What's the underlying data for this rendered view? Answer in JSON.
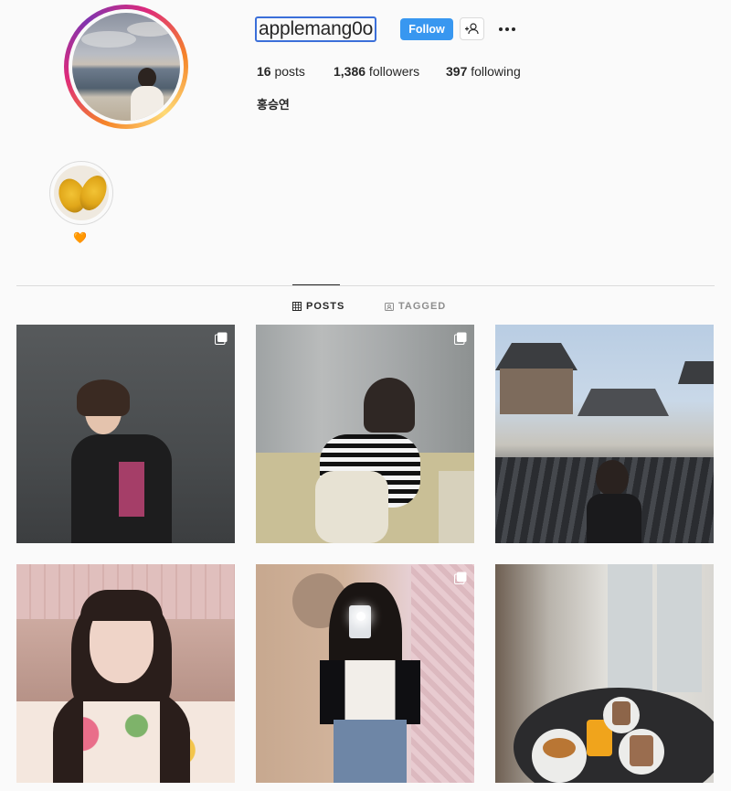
{
  "profile": {
    "username": "applemang0o",
    "full_name": "홍승연",
    "follow_label": "Follow",
    "ring_colors": [
      "#f58529",
      "#dd2a7b",
      "#8134af",
      "#feda77"
    ]
  },
  "stats": {
    "posts_count": "16",
    "posts_label": " posts",
    "followers_count": "1,386",
    "followers_label": " followers",
    "following_count": "397",
    "following_label": " following"
  },
  "highlights": [
    {
      "label": "🧡"
    }
  ],
  "tabs": [
    {
      "label": "POSTS",
      "icon": "grid-icon",
      "active": true
    },
    {
      "label": "TAGGED",
      "icon": "tag-icon",
      "active": false
    }
  ],
  "posts": [
    {
      "row": 1,
      "col": 1,
      "multi": true
    },
    {
      "row": 1,
      "col": 2,
      "multi": true
    },
    {
      "row": 1,
      "col": 3,
      "multi": false
    },
    {
      "row": 2,
      "col": 1,
      "multi": false
    },
    {
      "row": 2,
      "col": 2,
      "multi": true
    },
    {
      "row": 2,
      "col": 3,
      "multi": false
    }
  ],
  "colors": {
    "follow_button": "#3897f0",
    "text": "#262626",
    "muted": "#8e8e8e",
    "divider": "#dbdbdb",
    "background": "#fafafa"
  }
}
